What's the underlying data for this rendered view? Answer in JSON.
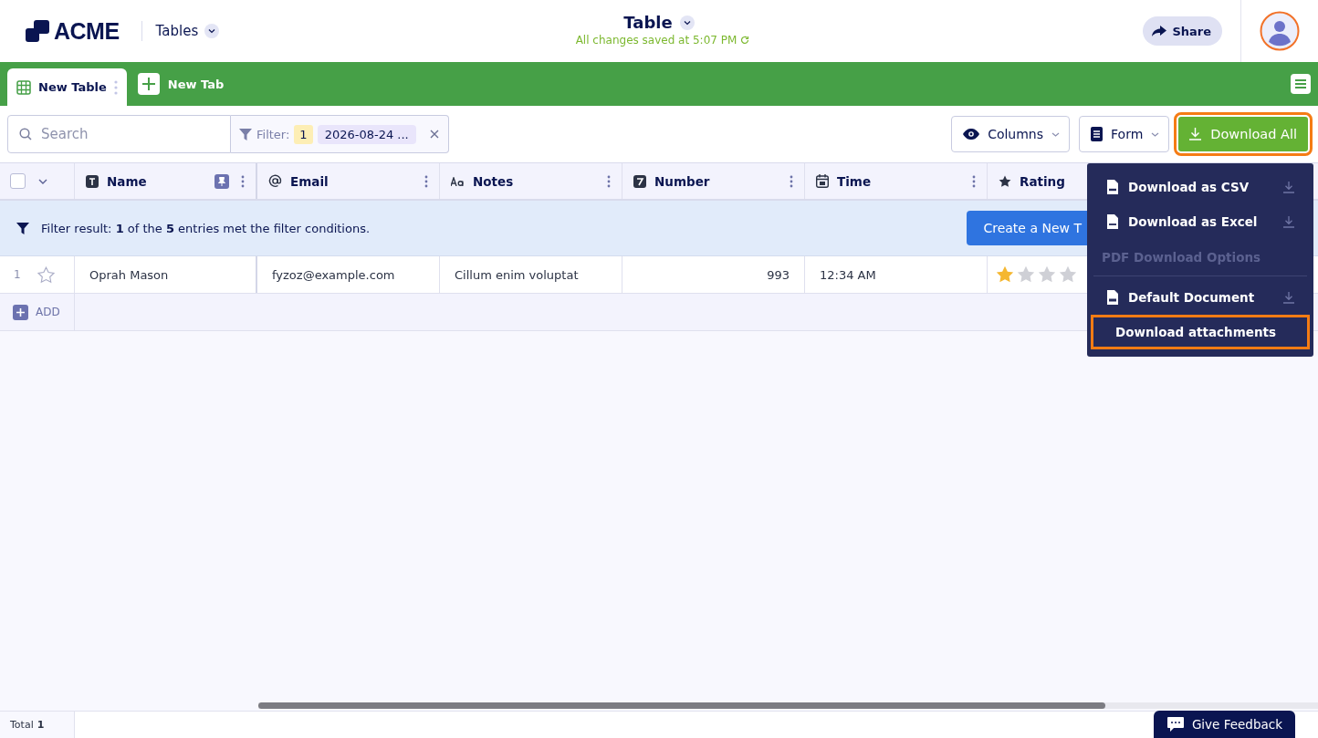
{
  "header": {
    "logo": "ACME",
    "app_menu": "Tables",
    "title": "Table",
    "save_status": "All changes saved at 5:07 PM",
    "share": "Share"
  },
  "tabs": [
    {
      "label": "New Table",
      "selected": true
    }
  ],
  "add_tab": "New Tab",
  "toolbar": {
    "search": {
      "placeholder": "Search"
    },
    "filter": {
      "label": "Filter:",
      "count": "1",
      "value": "2026-08-24 ..."
    },
    "columns": "Columns",
    "form": "Form",
    "download": {
      "label": "Download All",
      "highlighted": true
    }
  },
  "table": {
    "select_all": {
      "checked": false
    },
    "columns": [
      {
        "name": "Name",
        "kind": "text",
        "pinned": true
      },
      {
        "name": "Email",
        "kind": "email",
        "pinned": false
      },
      {
        "name": "Notes",
        "kind": "notes",
        "pinned": false
      },
      {
        "name": "Number",
        "kind": "number",
        "pinned": false
      },
      {
        "name": "Time",
        "kind": "time",
        "pinned": false
      },
      {
        "name": "Rating",
        "kind": "rating",
        "pinned": false
      }
    ],
    "filter_banner": {
      "text": "Filter result: **1** of the **5** entries met the filter conditions.",
      "button": "Create a New T"
    },
    "rows": [
      {
        "number": "1",
        "starred": false,
        "cells": [
          "Oprah Mason",
          "fyzoz@example.com",
          "Cillum enim voluptat",
          "993",
          "12:34 AM"
        ],
        "stars": 1
      }
    ],
    "add": "ADD"
  },
  "download_menu": [
    {
      "kind": "csv",
      "label": "Download as CSV",
      "highlighted": false
    },
    {
      "kind": "excel",
      "label": "Download as Excel",
      "highlighted": false
    },
    {
      "kind": "heading",
      "label": "PDF Download Options"
    },
    {
      "kind": "pdf",
      "label": "Default Document",
      "highlighted": false
    },
    {
      "kind": "attachments",
      "label": "Download attachments",
      "highlighted": true
    }
  ],
  "footer": {
    "total_label": "Total",
    "total_count": "1",
    "feedback": "Give Feedback"
  }
}
